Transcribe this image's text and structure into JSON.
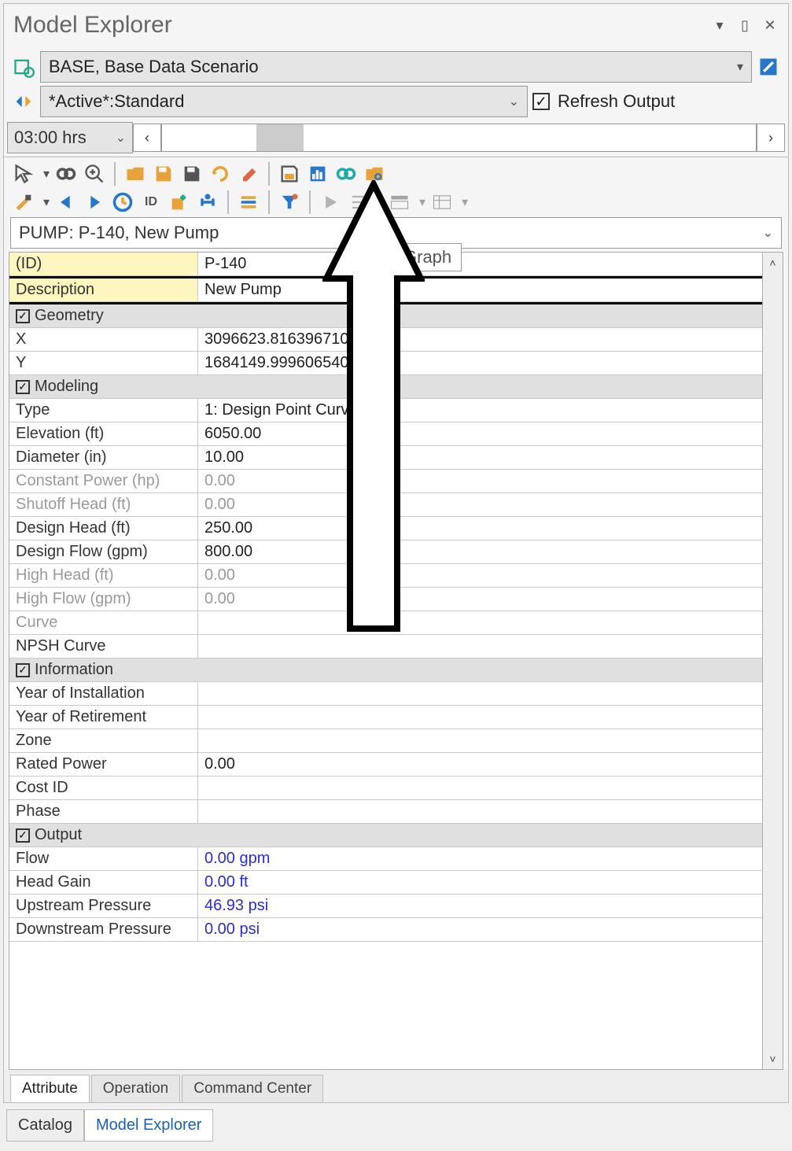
{
  "window": {
    "title": "Model Explorer",
    "scenario": "BASE, Base Data Scenario",
    "active": "*Active*:Standard",
    "refresh_label": "Refresh Output",
    "refresh_checked": true,
    "time": "03:00 hrs",
    "selection": "PUMP: P-140, New Pump",
    "tooltip": "Graph"
  },
  "props": {
    "id_label": "(ID)",
    "id_value": "P-140",
    "desc_label": "Description",
    "desc_value": "New Pump",
    "sect_geometry": "Geometry",
    "x_label": "X",
    "x_value": "3096623.816396710",
    "y_label": "Y",
    "y_value": "1684149.999606540",
    "sect_modeling": "Modeling",
    "type_label": "Type",
    "type_value": "1: Design Point Curve",
    "elev_label": "Elevation (ft)",
    "elev_value": "6050.00",
    "diam_label": "Diameter (in)",
    "diam_value": "10.00",
    "cpow_label": "Constant Power (hp)",
    "cpow_value": "0.00",
    "shut_label": "Shutoff Head (ft)",
    "shut_value": "0.00",
    "dhead_label": "Design Head (ft)",
    "dhead_value": "250.00",
    "dflow_label": "Design Flow (gpm)",
    "dflow_value": "800.00",
    "hhead_label": "High Head (ft)",
    "hhead_value": "0.00",
    "hflow_label": "High Flow (gpm)",
    "hflow_value": "0.00",
    "curve_label": "Curve",
    "curve_value": "",
    "npsh_label": "NPSH Curve",
    "npsh_value": "",
    "sect_info": "Information",
    "yinst_label": "Year of Installation",
    "yinst_value": "",
    "yret_label": "Year of Retirement",
    "yret_value": "",
    "zone_label": "Zone",
    "zone_value": "",
    "rpow_label": "Rated Power",
    "rpow_value": "0.00",
    "cost_label": "Cost ID",
    "cost_value": "",
    "phase_label": "Phase",
    "phase_value": "",
    "sect_output": "Output",
    "flow_label": "Flow",
    "flow_value": "0.00 gpm",
    "hgain_label": "Head Gain",
    "hgain_value": "0.00 ft",
    "upres_label": "Upstream Pressure",
    "upres_value": "46.93 psi",
    "dpres_label": "Downstream Pressure",
    "dpres_value": "0.00 psi"
  },
  "tabs": {
    "inner": [
      "Attribute",
      "Operation",
      "Command Center"
    ],
    "inner_active": 0,
    "outer": [
      "Catalog",
      "Model Explorer"
    ],
    "outer_active": 1
  }
}
